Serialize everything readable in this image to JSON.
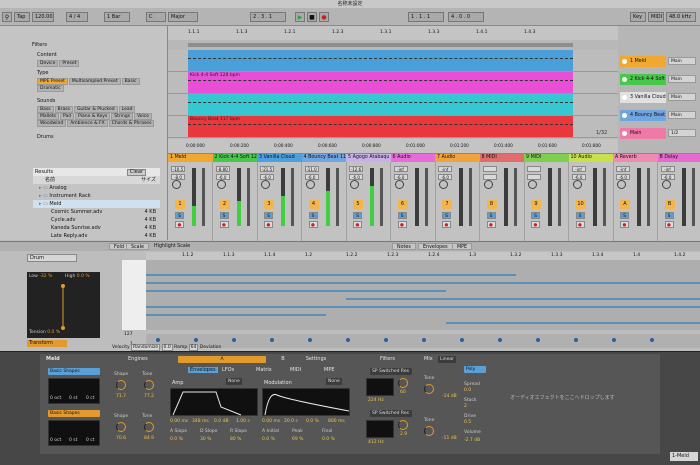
{
  "window_title": "名称未設定",
  "transport": {
    "tap": "Tap",
    "tempo": "120.00",
    "time_sig": "4 / 4",
    "quantize": "1 Bar",
    "key": "C",
    "scale": "Major",
    "position": "2 . 3 . 1",
    "loop_start": "1 . 1 . 1",
    "loop_len": "4 . 0 . 0",
    "key_btn": "Key",
    "midi_btn": "MIDI",
    "sample_rate": "48.0 kHz"
  },
  "browser": {
    "filters_label": "Filters",
    "content_label": "Content",
    "content_tags": [
      {
        "t": "Device",
        "on": false
      },
      {
        "t": "Preset",
        "on": false
      }
    ],
    "type_label": "Type",
    "type_tags": [
      {
        "t": "MPE Preset",
        "on": true
      },
      {
        "t": "Multisampled Preset",
        "on": false
      },
      {
        "t": "Basic",
        "on": false
      },
      {
        "t": "Dramatic",
        "on": false
      }
    ],
    "sounds_label": "Sounds",
    "sounds_tags": [
      {
        "t": "Bass",
        "on": false
      },
      {
        "t": "Brass",
        "on": false
      },
      {
        "t": "Guitar & Plucked",
        "on": false
      },
      {
        "t": "Lead",
        "on": false
      },
      {
        "t": "Mallets",
        "on": false
      },
      {
        "t": "Pad",
        "on": false
      },
      {
        "t": "Piano & Keys",
        "on": false
      },
      {
        "t": "Strings",
        "on": false
      },
      {
        "t": "Voice",
        "on": false
      },
      {
        "t": "Woodwind",
        "on": false
      },
      {
        "t": "Ambience & FX",
        "on": false
      },
      {
        "t": "Chords & Phrases",
        "on": false
      }
    ],
    "drums_label": "Drums",
    "results_label": "Results",
    "clear_label": "Clear",
    "name_col": "名前",
    "size_col": "サイズ",
    "folders": [
      "Analog",
      "Instrument Rack",
      "Meld"
    ],
    "files": [
      {
        "name": "Cosmic Summer.adv",
        "size": "4 KB"
      },
      {
        "name": "Cycle.adv",
        "size": "4 KB"
      },
      {
        "name": "Kaneda Sunrise.adv",
        "size": "4 KB"
      },
      {
        "name": "Late Reply.adv",
        "size": "4 KB"
      },
      {
        "name": "Outskirts.adv",
        "size": "4 KB"
      }
    ]
  },
  "arrangement": {
    "ruler": [
      "1.1.1",
      "1.1.3",
      "1.2.1",
      "1.2.3",
      "1.3.1",
      "1.3.3",
      "1.4.1",
      "1.4.3"
    ],
    "times": [
      "0:00:000",
      "0:00:200",
      "0:00:400",
      "0:00:600",
      "0:00:800",
      "0:01:000",
      "0:01:200",
      "0:01:400",
      "0:01:600",
      "0:01:800"
    ],
    "clips": [
      {
        "label": "",
        "color": "#4b9fd9"
      },
      {
        "label": "Kick 4-4 Soft 128 bpm",
        "color": "#e94fd6"
      },
      {
        "label": "",
        "color": "#35c8d3"
      },
      {
        "label": "Bouncy Beat 117 bpm",
        "color": "#e8383d"
      }
    ],
    "fraction": "1/32"
  },
  "tracks_side": [
    {
      "name": "1 Meld",
      "color": "#f0a830",
      "route": "Main"
    },
    {
      "name": "2 Kick 4-4 Soft",
      "color": "#48c84a",
      "route": "Main"
    },
    {
      "name": "3 Vanilla Cloud",
      "color": "#e0e0e0",
      "route": "Main"
    },
    {
      "name": "4 Bouncy Beat",
      "color": "#6fa5e0",
      "route": "Main"
    },
    {
      "name": "Main",
      "color": "#ef7aa7",
      "route": "1/2"
    }
  ],
  "mixer": {
    "channels": [
      {
        "name": "1 Meld",
        "color": "#f0a830",
        "vol": "-10.5",
        "pan": "-8.0",
        "num": "1"
      },
      {
        "name": "2 Kick 4-4 Soft 12",
        "color": "#48c84a",
        "vol": "-8.80",
        "pan": "-6.0",
        "num": "2"
      },
      {
        "name": "3 Vanilla Cloud",
        "color": "#4aa0e0",
        "vol": "-21.5",
        "pan": "-6.0",
        "num": "3"
      },
      {
        "name": "4 Bouncy Beat 11",
        "color": "#6fa5e0",
        "vol": "-11.0",
        "pan": "-6.0",
        "num": "4"
      },
      {
        "name": "5 Agogo Atabaqu",
        "color": "#c9b0e9",
        "vol": "-12.6",
        "pan": "-6.0",
        "num": "5"
      },
      {
        "name": "6 Audio",
        "color": "#e96bd9",
        "vol": "-inf",
        "pan": "-6.0",
        "num": "6"
      },
      {
        "name": "7 Audio",
        "color": "#f2a23c",
        "vol": "-inf",
        "pan": "-6.0",
        "num": "7"
      },
      {
        "name": "8 MIDI",
        "color": "#e26b6b",
        "vol": "",
        "pan": "",
        "num": "8"
      },
      {
        "name": "9 MIDI",
        "color": "#7fcf4f",
        "vol": "",
        "pan": "",
        "num": "9"
      },
      {
        "name": "10 Audio",
        "color": "#c7e04b",
        "vol": "-inf",
        "pan": "-6.0",
        "num": "10"
      },
      {
        "name": "A Reverb",
        "color": "#f08ab0",
        "vol": "-inf",
        "pan": "-6.0",
        "num": "A"
      },
      {
        "name": "B Delay",
        "color": "#e86ad0",
        "vol": "-inf",
        "pan": "-6.0",
        "num": "B"
      }
    ]
  },
  "clip_editor": {
    "tabs": [
      "Fold",
      "Scale",
      "Highlight Scale"
    ],
    "mode_tabs": [
      "Notes",
      "Envelopes",
      "MPE"
    ],
    "shape_select": "Drum",
    "low_label": "Low",
    "low_val": "-32 %",
    "high_label": "High",
    "high_val": "0.0 %",
    "tension_label": "Tension",
    "tension_val": "0.0 %",
    "transform_label": "Transform",
    "velocity_label": "Velocity",
    "randomize_label": "Randomize",
    "randomize_val": "0.0",
    "ramp_label": "Ramp",
    "deviation_label": "Deviation",
    "chance_val": "64",
    "vel_max": "127",
    "vel_min": "1",
    "ruler": [
      "1.1.2",
      "1.1.3",
      "1.1.4",
      "1.2",
      "1.2.2",
      "1.2.3",
      "1.2.4",
      "1.3",
      "1.3.2",
      "1.3.3",
      "1.3.4",
      "1.4",
      "1.4.2"
    ]
  },
  "device": {
    "name": "Meld",
    "engines_label": "Engines",
    "osc_a": "Basic Shapes",
    "osc_b": "Basic Shapes",
    "shape_label": "Shape",
    "tone_label": "Tone",
    "shape_a": "71.7",
    "tone_a": "77.2",
    "shape_b": "70.6",
    "tone_b": "84.9",
    "oct_labels": [
      "0 oct",
      "0 st",
      "0 ct"
    ],
    "tabs": [
      "A",
      "B",
      "Settings"
    ],
    "subtabs": [
      "Envelopes",
      "LFOs",
      "Matrix",
      "MIDI",
      "MPE"
    ],
    "amp_label": "Amp",
    "modulation_label": "Modulation",
    "none": "None",
    "amp_vals": [
      "0.00 ms",
      "348 ms",
      "0.0 dB",
      "1.00 s"
    ],
    "amp_slopes": [
      "A Slope",
      "D Slope",
      "R Slope"
    ],
    "amp_slope_vals": [
      "0.0 %",
      "30 %",
      "80 %"
    ],
    "mod_vals": [
      "0.00 ms",
      "20.0 s",
      "0.0 %",
      "800 ms"
    ],
    "mod_labels": [
      "A Initial",
      "Peak",
      "Final"
    ],
    "mod_label_vals": [
      "0.0 %",
      "69 %",
      "0.0 %"
    ],
    "filters_label": "Filters",
    "filter_a": "SP Switched Res",
    "filter_b": "SP Switched Res",
    "filter_a_freq": "224 Hz",
    "filter_b_freq": "412 Hz",
    "res_a": "60",
    "res_b": "2.9",
    "mix_label": "Mix",
    "mix_mode": "Linear",
    "tone_a_db": "-14 dB",
    "tone_b_db": "-11 dB",
    "tone_label2": "Tone",
    "spread_label": "Spread",
    "spread_val": "0.0",
    "stack_label": "Stack",
    "stack_val": "2",
    "drive_label": "Drive",
    "drive_val": "0.5",
    "volume_label": "Volume",
    "volume_val": "-2.7 dB",
    "poly_mode": "Poly",
    "drop_hint": "オーディオエフェクトをここへドロップします",
    "footer_track": "1-Meld"
  }
}
